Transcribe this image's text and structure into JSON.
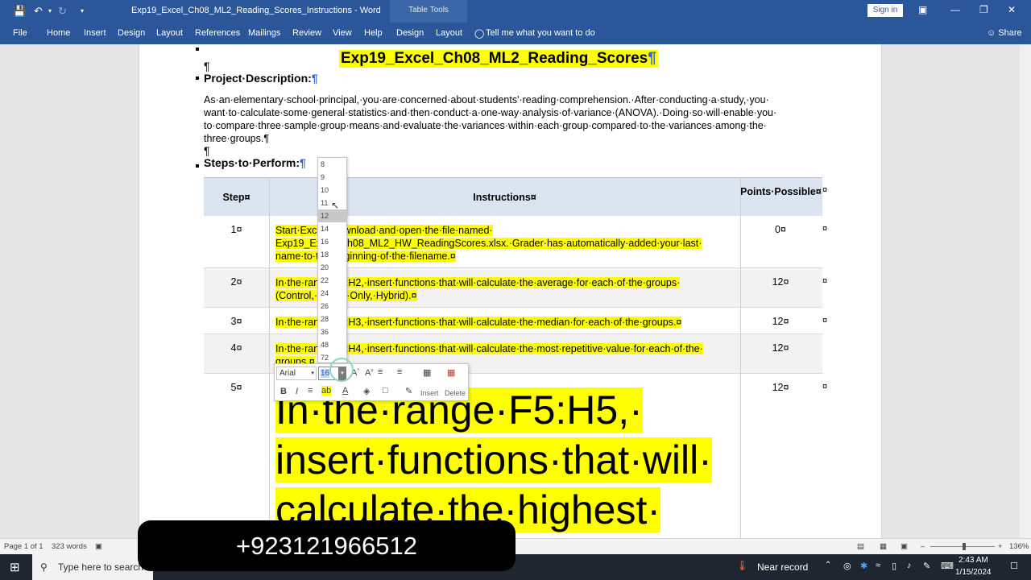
{
  "titlebar": {
    "doc_title": "Exp19_Excel_Ch08_ML2_Reading_Scores_Instructions  -  Word",
    "contextual_tab": "Table Tools",
    "sign_in": "Sign in"
  },
  "ribbon": {
    "tabs": [
      "File",
      "Home",
      "Insert",
      "Design",
      "Layout",
      "References",
      "Mailings",
      "Review",
      "View",
      "Help",
      "Design",
      "Layout"
    ],
    "tell_me": "Tell me what you want to do",
    "share": "Share"
  },
  "document": {
    "title": "Exp19_Excel_Ch08_ML2_Reading_Scores",
    "pilcrow": "¶",
    "project_heading": "Project·Description:",
    "project_text": "As·an·elementary·school·principal,·you·are·concerned·about·students'·reading·comprehension.·After·conducting·a·study,·you· want·to·calculate·some·general·statistics·and·then·conduct·a·one-way·analysis·of·variance·(ANOVA).·Doing·so·will·enable·you· to·compare·three·sample·group·means·and·evaluate·the·variances·within·each·group·compared·to·the·variances·among·the· three·groups.¶",
    "steps_heading": "Steps·to·Perform:",
    "table": {
      "headers": {
        "step": "Step¤",
        "instructions": "Instructions¤",
        "points": "Points·Possible¤",
        "end": "¤"
      },
      "rows": [
        {
          "step": "1¤",
          "text": "Start·Excel.·Download·and·open·the·file·named· Exp19_Excel_Ch08_ML2_HW_ReadingScores.xlsx.·Grader·has·automatically·added·your·last· name·to·the·beginning·of·the·filename.¤",
          "points": "0¤",
          "end": "¤"
        },
        {
          "step": "2¤",
          "text": "In·the·range·F2:H2,·insert·functions·that·will·calculate·the·average·for·each·of·the·groups· (Control,·Online·Only,·Hybrid).¤",
          "points": "12¤",
          "end": "¤"
        },
        {
          "step": "3¤",
          "text": "In·the·range·F3:H3,·insert·functions·that·will·calculate·the·median·for·each·of·the·groups.¤",
          "points": "12¤",
          "end": "¤"
        },
        {
          "step": "4¤",
          "text": "In·the·range·F4:H4,·insert·functions·that·will·calculate·the·most·repetitive·value·for·each·of·the· groups.¤",
          "points": "12¤",
          "end": "¤"
        },
        {
          "step": "5¤",
          "text": "In·the·range·F5:H5,· insert·functions·that·will· calculate·the·highest·",
          "points": "12¤",
          "end": "¤"
        }
      ]
    }
  },
  "font_size_dropdown": {
    "options": [
      "8",
      "9",
      "10",
      "11",
      "12",
      "14",
      "16",
      "18",
      "20",
      "22",
      "24",
      "26",
      "28",
      "36",
      "48",
      "72"
    ],
    "hovered": "12"
  },
  "mini_toolbar": {
    "font_name": "Arial",
    "font_size": "16",
    "insert_label": "Insert",
    "delete_label": "Delete"
  },
  "status": {
    "page": "Page 1 of 1",
    "words": "323 words",
    "zoom": "136%"
  },
  "taskbar": {
    "search_placeholder": "Type here to search",
    "weather": "Near record",
    "time": "2:43 AM",
    "date": "1/15/2024"
  },
  "overlay": {
    "phone": "+923121966512"
  },
  "colors": {
    "word_blue": "#2b579a",
    "highlight": "#ffff00",
    "table_header": "#dbe5f1"
  }
}
